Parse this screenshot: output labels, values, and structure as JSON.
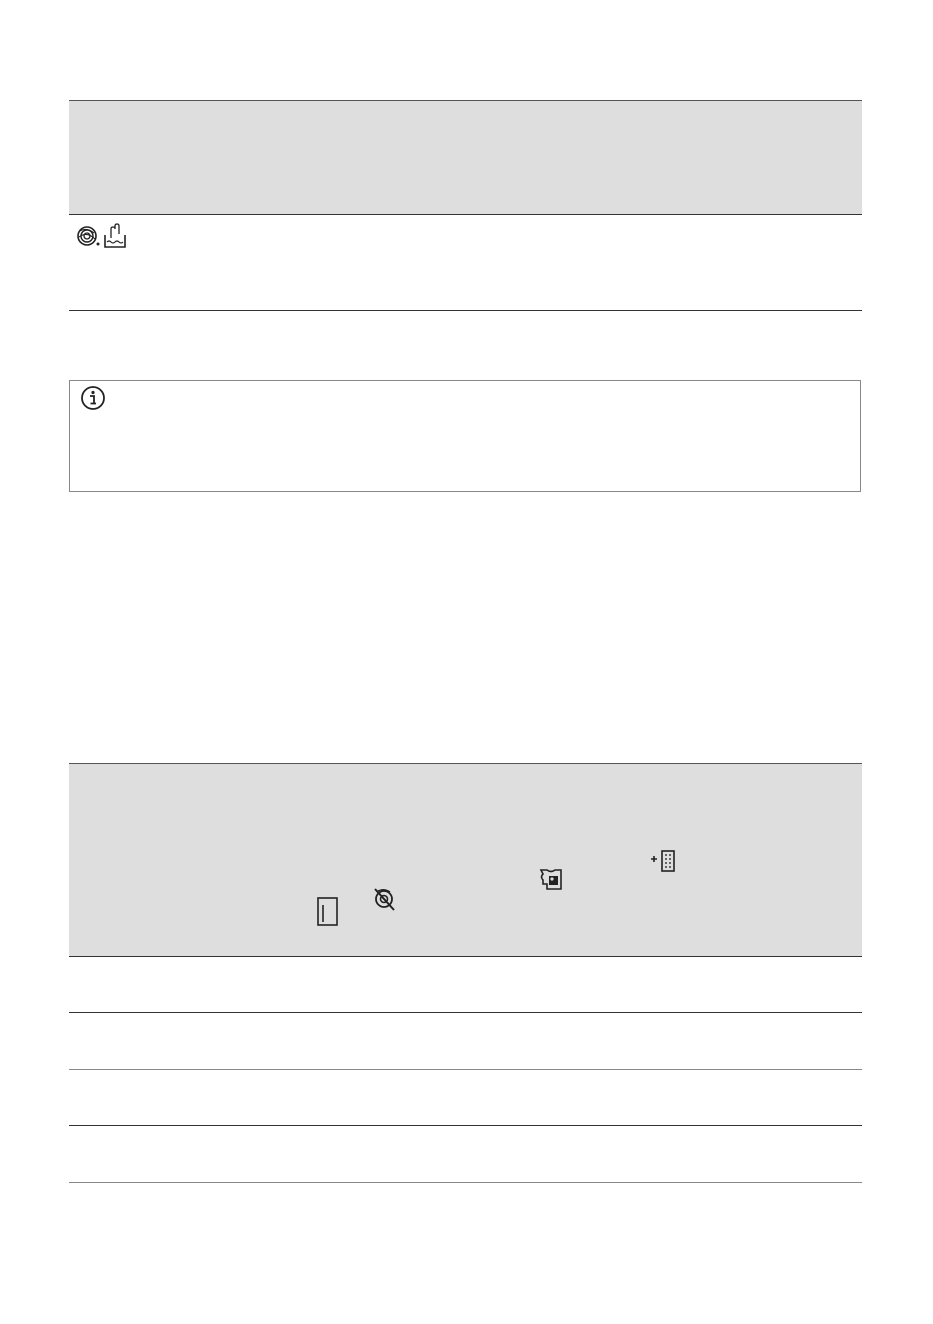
{
  "table_1": {
    "header_cells": [
      ""
    ],
    "rows": [
      {
        "icons": [
          "wool-icon",
          "hand-wash-icon"
        ],
        "text": ""
      }
    ]
  },
  "info_box": {
    "icon": "info-icon",
    "text": ""
  },
  "table_2": {
    "header_icons": [
      "door-icon",
      "no-spin-icon",
      "stain-icon",
      "extra-rinse-icon"
    ],
    "rows": [
      {
        "cells": [
          "",
          "",
          ""
        ]
      },
      {
        "cells": [
          "",
          "",
          ""
        ]
      },
      {
        "cells": [
          "",
          "",
          ""
        ]
      },
      {
        "cells": [
          "",
          "",
          ""
        ]
      }
    ]
  },
  "colors": {
    "header_fill": "#dedede",
    "rule": "#333333",
    "text": "#1a1a1a"
  }
}
